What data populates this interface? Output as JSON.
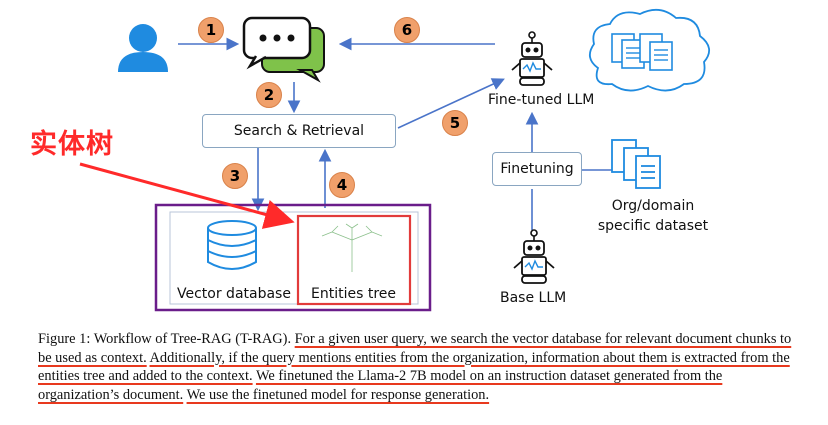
{
  "diagram": {
    "steps": [
      "1",
      "2",
      "3",
      "4",
      "5",
      "6"
    ],
    "search_retrieval": "Search & Retrieval",
    "finetuned_llm": "Fine-tuned LLM",
    "finetuning": "Finetuning",
    "dataset": "Org/domain specific dataset",
    "dataset_line1": "Org/domain",
    "dataset_line2": "specific dataset",
    "base_llm": "Base LLM",
    "vector_db": "Vector database",
    "entities_tree": "Entities tree",
    "annotation": "实体树",
    "colors": {
      "step_fill": "#f0a06b",
      "arrow": "#4a74c9",
      "annotation_red": "#ff2a2a",
      "group_border": "#6a1d8a",
      "highlight_border": "#e23b3b",
      "user_icon": "#1f8be0"
    },
    "icons": [
      "user-icon",
      "chat-bubbles-icon",
      "robot-icon",
      "documents-cloud-icon",
      "documents-icon",
      "database-icon",
      "tree-icon"
    ]
  },
  "caption": {
    "prefix": "Figure 1: Workflow of Tree-RAG (T-RAG). ",
    "s1": "For a given user query, we search the vector database for relevant document chunks to be used as context.",
    "s2": "Additionally, if the query mentions entities from the organization, information about them is extracted from the entities tree and added to the context.",
    "s3": "We finetuned the Llama-2 7B model on an instruction dataset generated from the organization’s document.",
    "s4": "We use the finetuned model for response generation."
  }
}
